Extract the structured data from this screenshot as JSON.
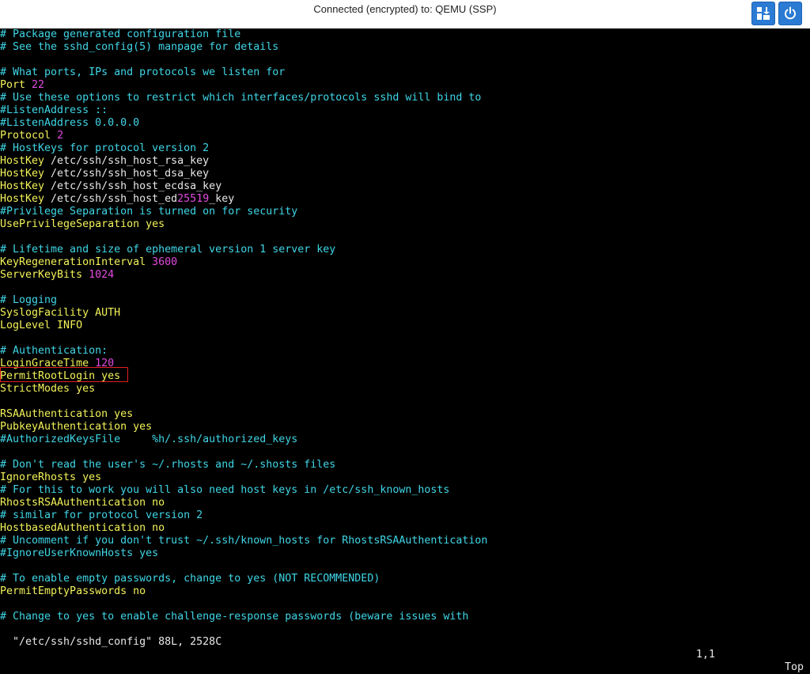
{
  "window": {
    "title": "Connected (encrypted) to: QEMU (SSP)",
    "buttons": [
      {
        "name": "send-keys-icon",
        "label": "Send keys"
      },
      {
        "name": "power-icon",
        "label": "Power"
      }
    ]
  },
  "colors": {
    "comment": "#3fd6e6",
    "keyword": "#f2f25a",
    "number": "#e24ce0",
    "text": "#e8e8e8",
    "highlight_box": "#e02020",
    "button_bg": "#2b7bd4"
  },
  "lines": [
    [
      {
        "t": "# Package generated configuration file",
        "c": "c"
      }
    ],
    [
      {
        "t": "# See the sshd_config(5) manpage for details",
        "c": "c"
      }
    ],
    [],
    [
      {
        "t": "# What ports, IPs and protocols we listen for",
        "c": "c"
      }
    ],
    [
      {
        "t": "Port ",
        "c": "y"
      },
      {
        "t": "22",
        "c": "m"
      }
    ],
    [
      {
        "t": "# Use these options to restrict which interfaces/protocols sshd will bind to",
        "c": "c"
      }
    ],
    [
      {
        "t": "#ListenAddress ::",
        "c": "c"
      }
    ],
    [
      {
        "t": "#ListenAddress 0.0.0.0",
        "c": "c"
      }
    ],
    [
      {
        "t": "Protocol ",
        "c": "y"
      },
      {
        "t": "2",
        "c": "m"
      }
    ],
    [
      {
        "t": "# HostKeys for protocol version 2",
        "c": "c"
      }
    ],
    [
      {
        "t": "HostKey",
        "c": "y"
      },
      {
        "t": " /etc/ssh/ssh_host_rsa_key",
        "c": "w"
      }
    ],
    [
      {
        "t": "HostKey",
        "c": "y"
      },
      {
        "t": " /etc/ssh/ssh_host_dsa_key",
        "c": "w"
      }
    ],
    [
      {
        "t": "HostKey",
        "c": "y"
      },
      {
        "t": " /etc/ssh/ssh_host_ecdsa_key",
        "c": "w"
      }
    ],
    [
      {
        "t": "HostKey",
        "c": "y"
      },
      {
        "t": " /etc/ssh/ssh_host_ed",
        "c": "w"
      },
      {
        "t": "25519",
        "c": "m"
      },
      {
        "t": "_key",
        "c": "w"
      }
    ],
    [
      {
        "t": "#Privilege Separation is turned on for security",
        "c": "c"
      }
    ],
    [
      {
        "t": "UsePrivilegeSeparation",
        "c": "y"
      },
      {
        "t": " yes",
        "c": "y"
      }
    ],
    [],
    [
      {
        "t": "# Lifetime and size of ephemeral version 1 server key",
        "c": "c"
      }
    ],
    [
      {
        "t": "KeyRegenerationInterval ",
        "c": "y"
      },
      {
        "t": "3600",
        "c": "m"
      }
    ],
    [
      {
        "t": "ServerKeyBits ",
        "c": "y"
      },
      {
        "t": "1024",
        "c": "m"
      }
    ],
    [],
    [
      {
        "t": "# Logging",
        "c": "c"
      }
    ],
    [
      {
        "t": "SyslogFacility",
        "c": "y"
      },
      {
        "t": " AUTH",
        "c": "y"
      }
    ],
    [
      {
        "t": "LogLevel",
        "c": "y"
      },
      {
        "t": " INFO",
        "c": "y"
      }
    ],
    [],
    [
      {
        "t": "# Authentication:",
        "c": "c"
      }
    ],
    [
      {
        "t": "LoginGraceTime ",
        "c": "y"
      },
      {
        "t": "120",
        "c": "m"
      }
    ],
    [
      {
        "t": "PermitRootLogin",
        "c": "y"
      },
      {
        "t": " yes",
        "c": "y"
      }
    ],
    [
      {
        "t": "StrictModes",
        "c": "y"
      },
      {
        "t": " yes",
        "c": "y"
      }
    ],
    [],
    [
      {
        "t": "RSAAuthentication",
        "c": "y"
      },
      {
        "t": " yes",
        "c": "y"
      }
    ],
    [
      {
        "t": "PubkeyAuthentication",
        "c": "y"
      },
      {
        "t": " yes",
        "c": "y"
      }
    ],
    [
      {
        "t": "#AuthorizedKeysFile     %h/.ssh/authorized_keys",
        "c": "c"
      }
    ],
    [],
    [
      {
        "t": "# Don't read the user's ~/.rhosts and ~/.shosts files",
        "c": "c"
      }
    ],
    [
      {
        "t": "IgnoreRhosts",
        "c": "y"
      },
      {
        "t": " yes",
        "c": "y"
      }
    ],
    [
      {
        "t": "# For this to work you will also need host keys in /etc/ssh_known_hosts",
        "c": "c"
      }
    ],
    [
      {
        "t": "RhostsRSAAuthentication",
        "c": "y"
      },
      {
        "t": " no",
        "c": "y"
      }
    ],
    [
      {
        "t": "# similar for protocol version 2",
        "c": "c"
      }
    ],
    [
      {
        "t": "HostbasedAuthentication",
        "c": "y"
      },
      {
        "t": " no",
        "c": "y"
      }
    ],
    [
      {
        "t": "# Uncomment if you don't trust ~/.ssh/known_hosts for RhostsRSAAuthentication",
        "c": "c"
      }
    ],
    [
      {
        "t": "#IgnoreUserKnownHosts yes",
        "c": "c"
      }
    ],
    [],
    [
      {
        "t": "# To enable empty passwords, change to yes (NOT RECOMMENDED)",
        "c": "c"
      }
    ],
    [
      {
        "t": "PermitEmptyPasswords",
        "c": "y"
      },
      {
        "t": " no",
        "c": "y"
      }
    ],
    [],
    [
      {
        "t": "# Change to yes to enable challenge-response passwords (beware issues with",
        "c": "c"
      }
    ]
  ],
  "status": {
    "file": "\"/etc/ssh/sshd_config\" 88L, 2528C",
    "position": "1,1",
    "scroll": "Top"
  }
}
